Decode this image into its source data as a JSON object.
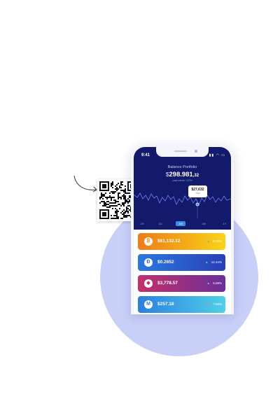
{
  "colors": {
    "hero": "#141a6b",
    "up": "#36d8a6",
    "down": "#ff6b8a",
    "accent": "#3a8ee8"
  },
  "status_bar": {
    "time": "9:41",
    "icons": "signal-wifi-battery"
  },
  "portfolio": {
    "title": "Balance Portfolio",
    "currency": "$",
    "amount": "298.981",
    "decimals": ",32",
    "sub_label": "past week",
    "sub_change": "+12%"
  },
  "tooltip": {
    "value": "$27,632",
    "date": "Sep"
  },
  "chart_tabs": [
    {
      "label": "1H",
      "active": false
    },
    {
      "label": "1D",
      "active": false
    },
    {
      "label": "1W",
      "active": true
    },
    {
      "label": "1M",
      "active": false
    },
    {
      "label": "1Y",
      "active": false
    }
  ],
  "coins": [
    {
      "icon": "bitcoin-icon",
      "glyph": "₿",
      "value": "$61,132.12",
      "change": "8.15%",
      "trend": "up",
      "gradient": [
        "#f07b19",
        "#f9d317"
      ],
      "icon_color": "#f28a1a"
    },
    {
      "icon": "dogecoin-icon",
      "glyph": "Đ",
      "value": "$0.2652",
      "change": "12.44%",
      "trend": "up",
      "gradient": [
        "#2a78e0",
        "#2a3fb8"
      ],
      "icon_color": "#2a6fd6"
    },
    {
      "icon": "ethereum-icon",
      "glyph": "◆",
      "value": "$3,778.57",
      "change": "5.69%",
      "trend": "up",
      "gradient": [
        "#c42f6a",
        "#6b2f9a"
      ],
      "icon_color": "#c42f6a"
    },
    {
      "icon": "monero-icon",
      "glyph": "M",
      "value": "$257.18",
      "change": "7.96%",
      "trend": "down",
      "gradient": [
        "#2c7fe0",
        "#4fd0e8"
      ],
      "icon_color": "#2c7fe0"
    }
  ]
}
